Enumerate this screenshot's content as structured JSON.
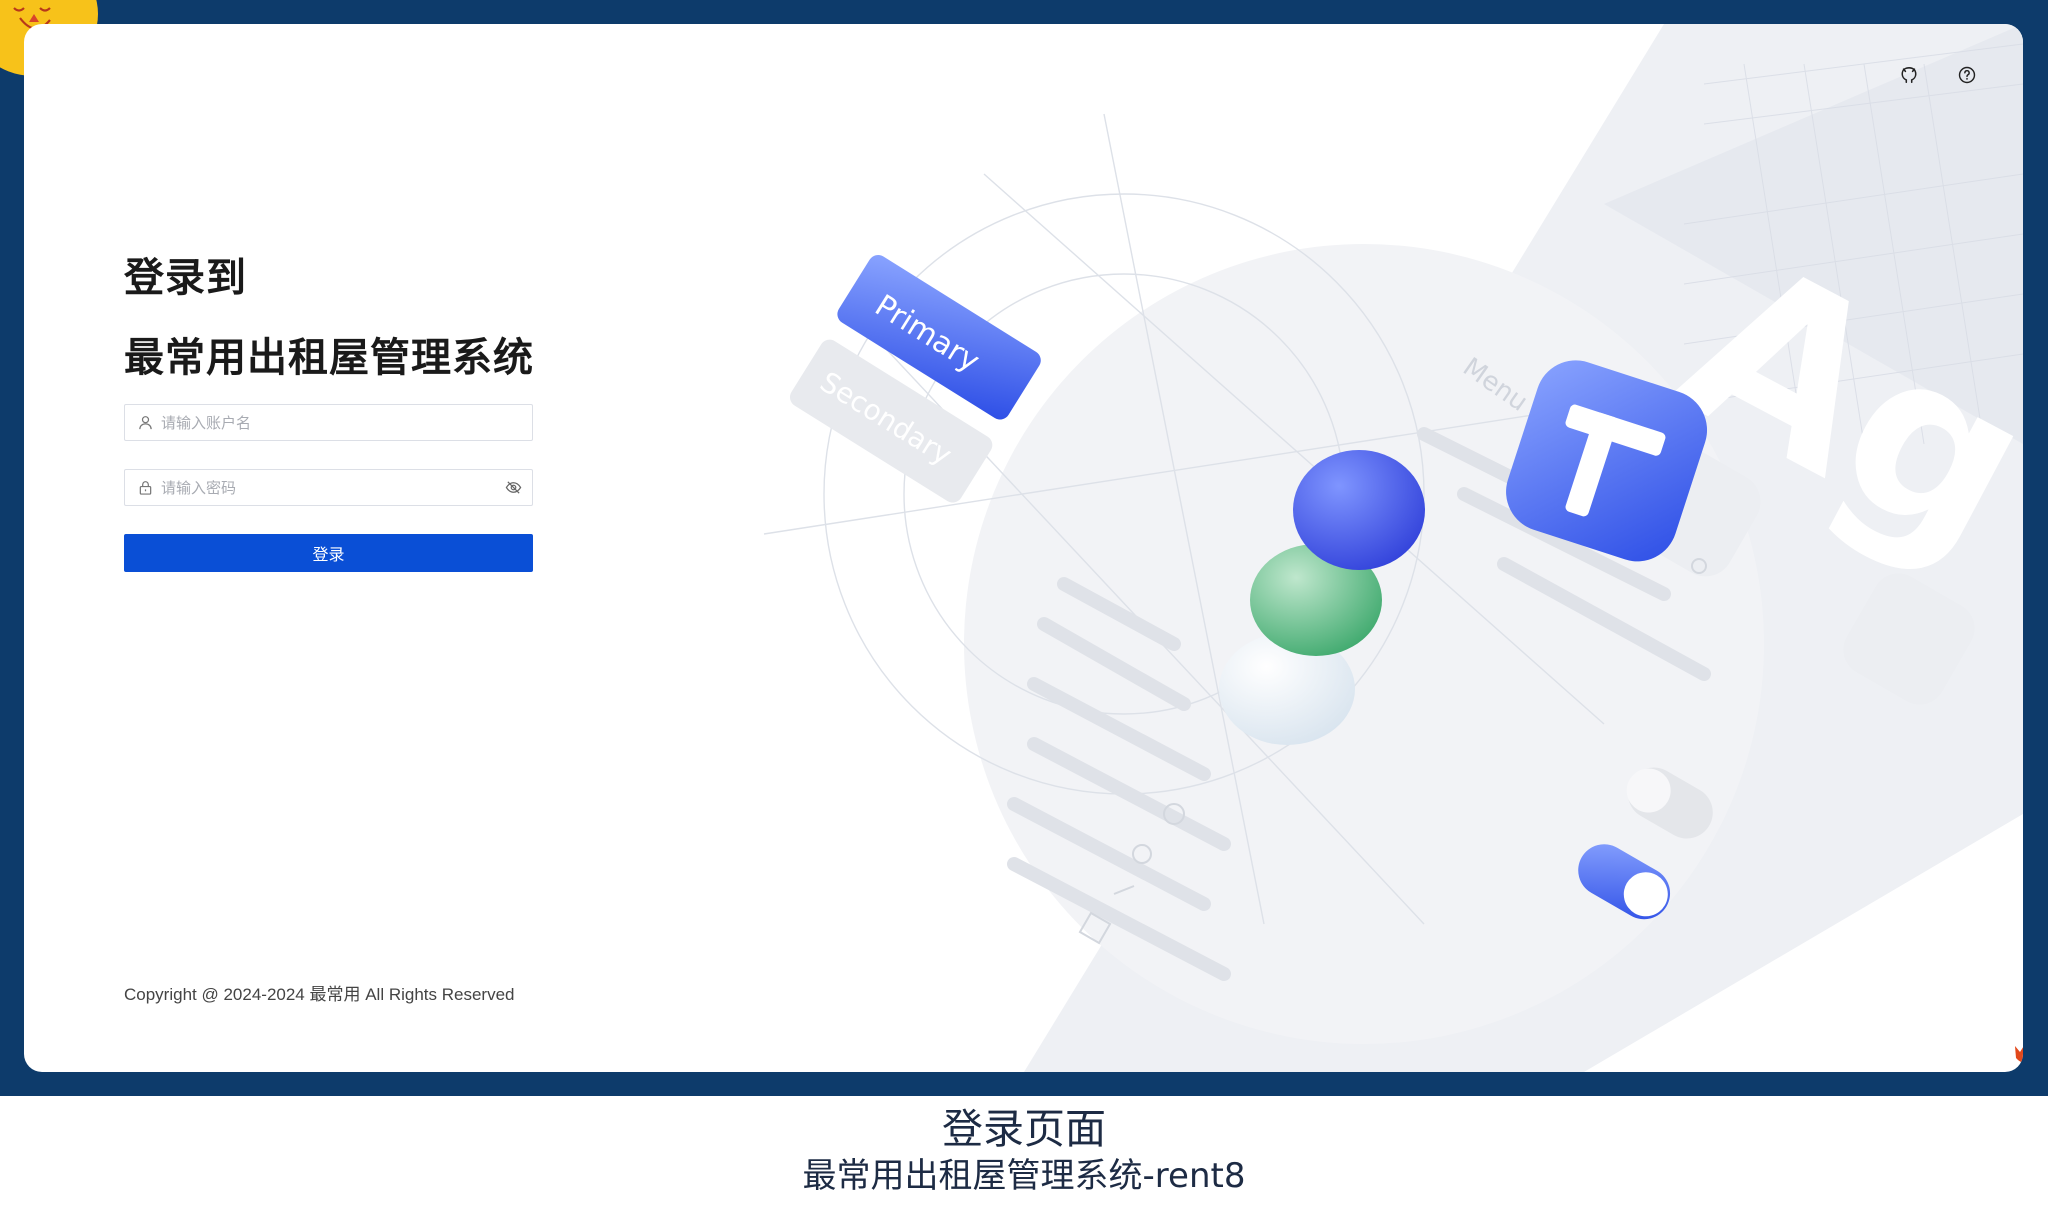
{
  "login": {
    "title_line1": "登录到",
    "title_line2": "最常用出租屋管理系统",
    "username_placeholder": "请输入账户名",
    "password_placeholder": "请输入密码",
    "submit_label": "登录"
  },
  "footer": {
    "copyright": "Copyright @ 2024-2024 最常用 All Rights Reserved"
  },
  "illustration": {
    "primary_label": "Primary",
    "secondary_label": "Secondary",
    "menu_label": "Menu",
    "ag_label": "Ag"
  },
  "toolbar": {
    "icons": [
      "github-icon",
      "help-icon"
    ]
  },
  "caption": {
    "line1": "登录页面",
    "line2": "最常用出租屋管理系统-rent8"
  },
  "colors": {
    "frame": "#0d3b6b",
    "button": "#0a4fd6",
    "sun": "#f7c21a"
  }
}
